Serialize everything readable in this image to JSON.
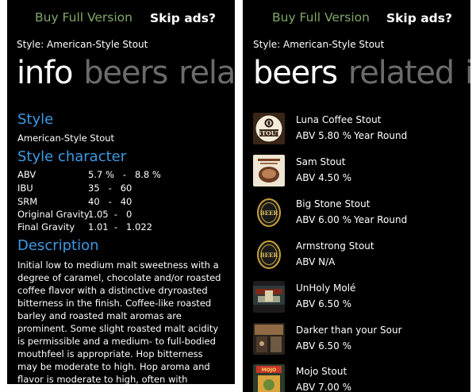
{
  "left": {
    "buy_label": "Buy Full Version",
    "skip_label": "Skip ads?",
    "style_line": "Style: American-Style Stout",
    "pivot": [
      "info",
      "beers",
      "relat"
    ],
    "style_heading": "Style",
    "style_value": "American-Style Stout",
    "character_heading": "Style character",
    "character": [
      {
        "label": "ABV",
        "value": "5.7 %   -   8.8 %"
      },
      {
        "label": "IBU",
        "value": "35   -   60"
      },
      {
        "label": "SRM",
        "value": "40   -   40"
      },
      {
        "label": "Original Gravity",
        "value": "1.05  -   0"
      },
      {
        "label": "Final Gravity",
        "value": "1.01  -   1.022"
      }
    ],
    "description_heading": "Description",
    "description": "Initial low to medium malt sweetness with a degree of caramel, chocolate and/or roasted coffee flavor with a distinctive dryroasted bitterness in the finish. Coffee-like roasted barley and roasted malt aromas are prominent. Some slight roasted malt acidity is permissible and a medium- to full-bodied mouthfeel is appropriate. Hop bitterness may be moderate to high. Hop aroma and flavor is moderate to high, often with American citrus-type and/or resiny"
  },
  "right": {
    "buy_label": "Buy Full Version",
    "skip_label": "Skip ads?",
    "style_line": "Style: American-Style Stout",
    "pivot": [
      "beers",
      "related",
      "in"
    ],
    "beers": [
      {
        "name": "Luna Coffee Stout",
        "abv": "ABV 5.80 %",
        "style": "Year Round",
        "icon": "luna-stout-logo-icon"
      },
      {
        "name": "Sam Stout",
        "abv": "ABV 4.50 %",
        "style": "",
        "icon": "sam-stout-label-icon"
      },
      {
        "name": "Big Stone Stout",
        "abv": "ABV 6.00 %",
        "style": "Year Round",
        "icon": "beer-cap-icon"
      },
      {
        "name": "Armstrong Stout",
        "abv": "ABV N/A",
        "style": "",
        "icon": "beer-cap-icon"
      },
      {
        "name": "UnHoly Molé",
        "abv": "ABV 6.50 %",
        "style": "",
        "icon": "unholy-mole-photo-icon"
      },
      {
        "name": "Darker than your Sour",
        "abv": "ABV 6.50 %",
        "style": "",
        "icon": "darker-sour-photo-icon"
      },
      {
        "name": "Mojo Stout",
        "abv": "ABV 7.00 %",
        "style": "",
        "icon": "mojo-stout-label-icon"
      }
    ]
  }
}
